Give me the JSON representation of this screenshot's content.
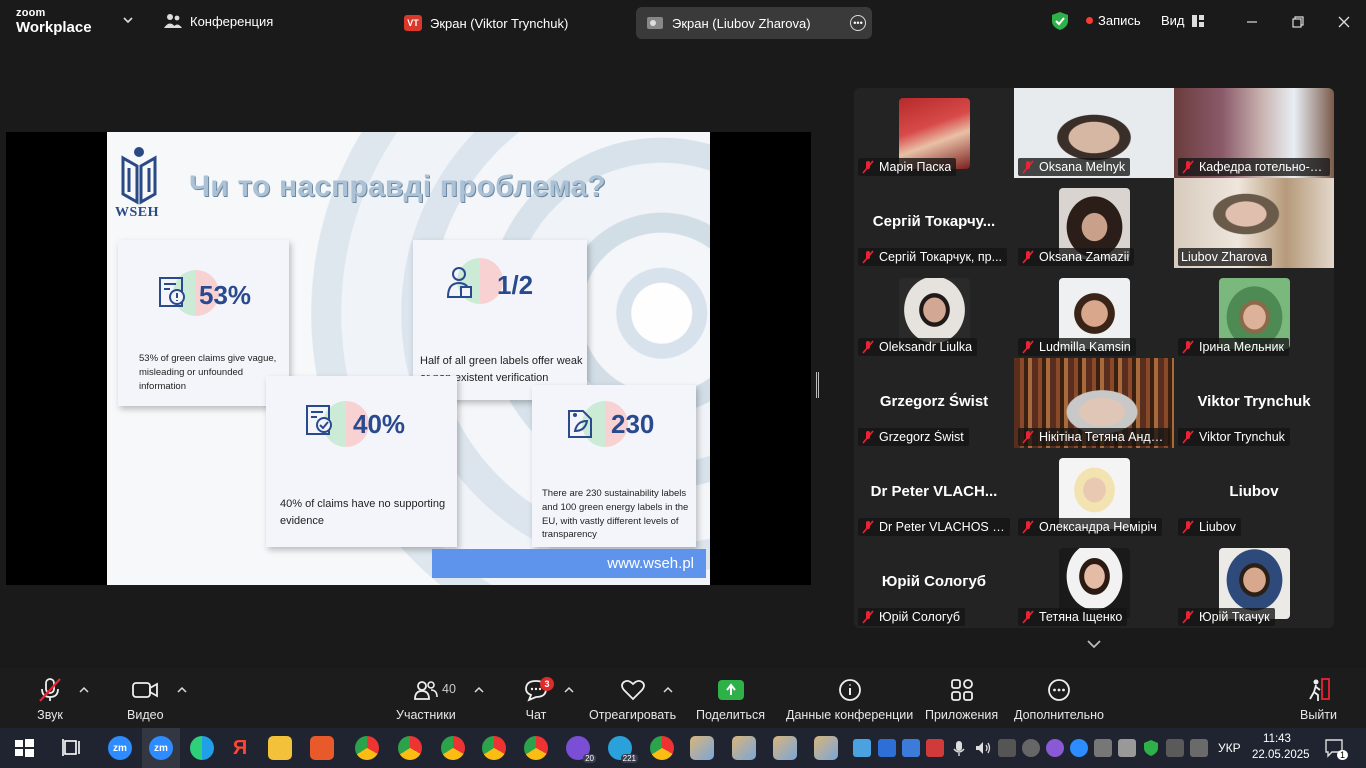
{
  "titlebar": {
    "brand_line1": "zoom",
    "brand_line2": "Workplace",
    "conference_label": "Конференция",
    "tab1": {
      "badge": "VT",
      "label": "Экран (Viktor Trynchuk)"
    },
    "tab2": {
      "label": "Экран (Liubov Zharova)"
    },
    "recording_label": "Запись",
    "view_label": "Вид",
    "colors": {
      "recording_dot": "#ff3b30",
      "shield": "#2fb14a"
    }
  },
  "slide": {
    "logo_text": "WSEH",
    "title": "Чи то насправді проблема?",
    "cards": [
      {
        "value": "53%",
        "text": "53% of green claims give vague, misleading or unfounded information",
        "icon": "document-alert-icon"
      },
      {
        "value": "1/2",
        "text": "Half of all green labels offer weak or non-existent verification",
        "icon": "shopper-icon"
      },
      {
        "value": "40%",
        "text": "40% of claims have no supporting evidence",
        "icon": "document-check-icon"
      },
      {
        "value": "230",
        "text": "There are 230 sustainability labels and 100 green energy labels in the EU, with vastly different levels of transparency",
        "icon": "eco-tag-icon"
      }
    ],
    "url": "www.wseh.pl"
  },
  "gallery": {
    "tiles": [
      {
        "name": "Марія Паска",
        "big": "",
        "type": "photo"
      },
      {
        "name": "Oksana Melnyk",
        "big": "",
        "type": "full"
      },
      {
        "name": "Кафедра готельно-р...",
        "big": "",
        "type": "full"
      },
      {
        "name": "Сергій Токарчук, пр...",
        "big": "Сергій Токарчу...",
        "type": "name"
      },
      {
        "name": "Oksana Zamazii",
        "big": "",
        "type": "photo"
      },
      {
        "name": "Liubov Zharova",
        "big": "",
        "type": "full"
      },
      {
        "name": "Oleksandr Liulka",
        "big": "",
        "type": "photo"
      },
      {
        "name": "Ludmilla Kamsin",
        "big": "",
        "type": "photo"
      },
      {
        "name": "Ірина Мельник",
        "big": "",
        "type": "photo"
      },
      {
        "name": "Grzegorz Świst",
        "big": "Grzegorz Świst",
        "type": "name"
      },
      {
        "name": "Нікітіна Тетяна Андрі...",
        "big": "",
        "type": "full"
      },
      {
        "name": "Viktor Trynchuk",
        "big": "Viktor Trynchuk",
        "type": "name"
      },
      {
        "name": "Dr Peter VLACHOS (U...",
        "big": "Dr Peter VLACH...",
        "type": "name"
      },
      {
        "name": "Олександра Неміріч",
        "big": "",
        "type": "photo"
      },
      {
        "name": "Liubov",
        "big": "Liubov",
        "type": "name"
      },
      {
        "name": "Юрій Сологуб",
        "big": "Юрій Сологуб",
        "type": "name"
      },
      {
        "name": "Тетяна Іщенко",
        "big": "",
        "type": "photo"
      },
      {
        "name": "Юрій Ткачук",
        "big": "",
        "type": "photo"
      }
    ],
    "active_speaker_color": "#4fd37a"
  },
  "toolbar": {
    "audio_label": "Звук",
    "video_label": "Видео",
    "participants_label": "Участники",
    "participants_count": "40",
    "chat_label": "Чат",
    "chat_badge": "3",
    "react_label": "Отреагировать",
    "share_label": "Поделиться",
    "info_label": "Данные конференции",
    "apps_label": "Приложения",
    "more_label": "Дополнительно",
    "leave_label": "Выйти"
  },
  "taskbar": {
    "badges": {
      "viber": "20",
      "telegram": "221"
    },
    "language": "УКР",
    "time": "11:43",
    "date": "22.05.2025",
    "notifications": "1"
  }
}
